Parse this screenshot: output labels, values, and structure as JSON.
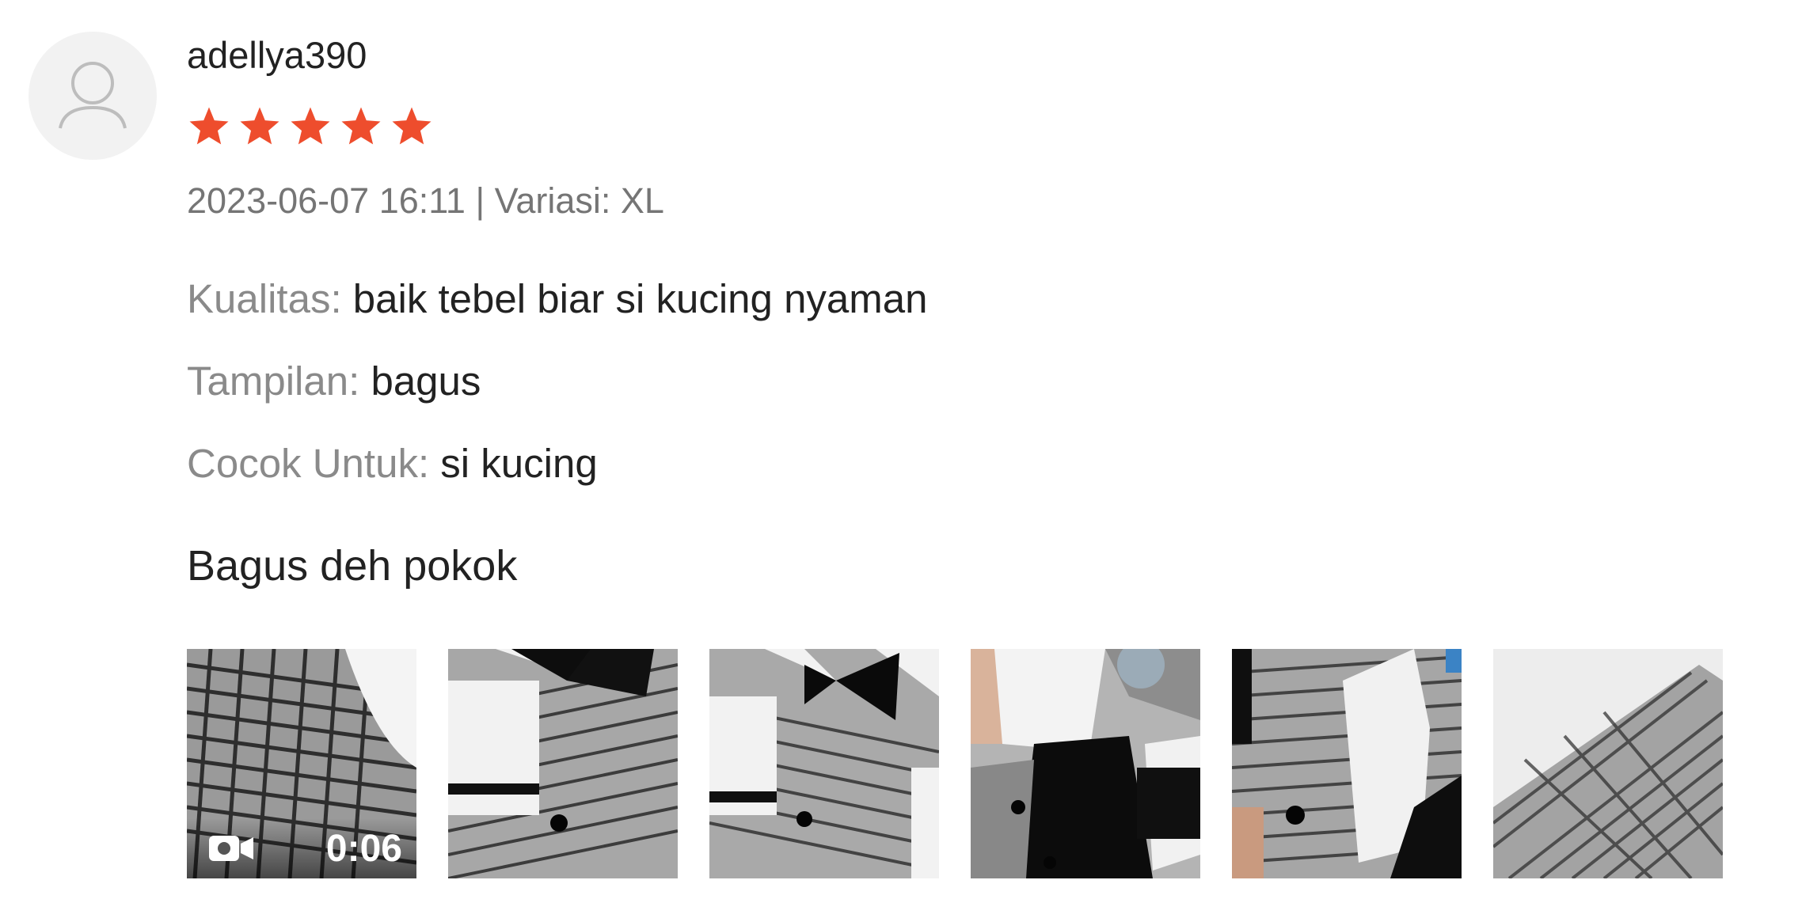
{
  "review": {
    "username": "adellya390",
    "rating": 5,
    "rating_max": 5,
    "star_color": "#ee4d2d",
    "date": "2023-06-07 16:11",
    "separator": " | ",
    "variation_label": "Variasi:",
    "variation_value": "XL",
    "attributes": [
      {
        "label": "Kualitas:",
        "value": "baik tebel biar si kucing nyaman"
      },
      {
        "label": "Tampilan:",
        "value": "bagus"
      },
      {
        "label": "Cocok Untuk:",
        "value": "si kucing"
      }
    ],
    "comment": "Bagus deh pokok",
    "media": [
      {
        "type": "video",
        "icon": "video-camera-icon",
        "duration": "0:06"
      },
      {
        "type": "image"
      },
      {
        "type": "image"
      },
      {
        "type": "image"
      },
      {
        "type": "image"
      },
      {
        "type": "image"
      }
    ]
  }
}
